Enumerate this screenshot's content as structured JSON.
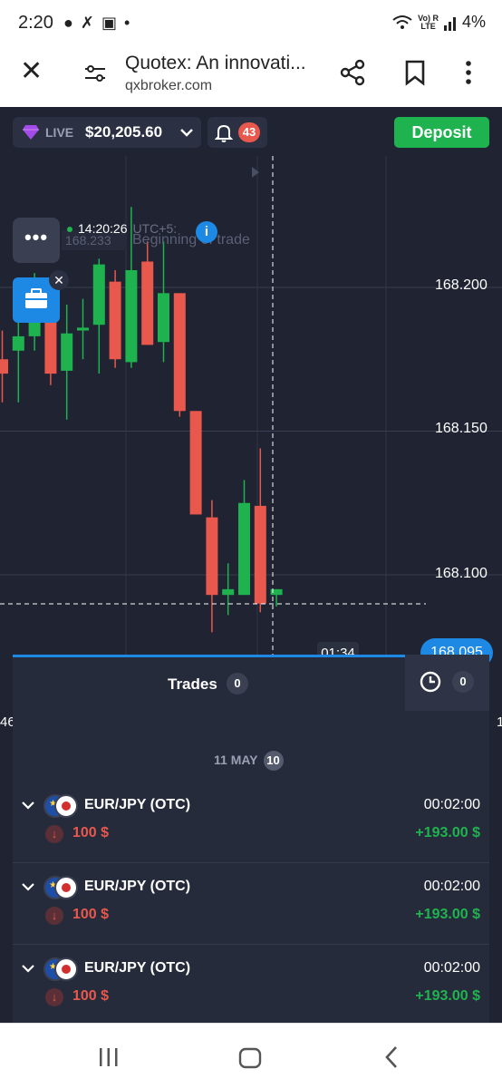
{
  "status_bar": {
    "time": "2:20",
    "signal_label": "Vo) R\nLTE",
    "battery": "4%"
  },
  "browser": {
    "title": "Quotex: An innovati...",
    "url": "qxbroker.com"
  },
  "account": {
    "mode": "LIVE",
    "balance": "$20,205.60",
    "notifications": "43",
    "deposit_label": "Deposit"
  },
  "chart": {
    "timestamp": "14:20:26",
    "timezone": "UTC+5:",
    "ghost_price": "168.233",
    "ghost_label": "Beginning of trade",
    "price_levels": [
      "168.200",
      "168.150",
      "168.100"
    ],
    "current_price": "168.095",
    "timer": "01:34",
    "colors": {
      "up": "#1fb34f",
      "down": "#e8584d",
      "accent": "#1e88e5"
    },
    "candles": [
      {
        "open": 168.175,
        "close": 168.17,
        "high": 168.185,
        "low": 168.16
      },
      {
        "open": 168.178,
        "close": 168.183,
        "high": 168.2,
        "low": 168.16
      },
      {
        "open": 168.183,
        "close": 168.196,
        "high": 168.205,
        "low": 168.178
      },
      {
        "open": 168.191,
        "close": 168.17,
        "high": 168.196,
        "low": 168.166
      },
      {
        "open": 168.171,
        "close": 168.184,
        "high": 168.194,
        "low": 168.154
      },
      {
        "open": 168.185,
        "close": 168.186,
        "high": 168.196,
        "low": 168.175
      },
      {
        "open": 168.187,
        "close": 168.208,
        "high": 168.21,
        "low": 168.17
      },
      {
        "open": 168.202,
        "close": 168.175,
        "high": 168.206,
        "low": 168.172
      },
      {
        "open": 168.174,
        "close": 168.206,
        "high": 168.228,
        "low": 168.172
      },
      {
        "open": 168.209,
        "close": 168.18,
        "high": 168.216,
        "low": 168.18
      },
      {
        "open": 168.181,
        "close": 168.198,
        "high": 168.216,
        "low": 168.174
      },
      {
        "open": 168.198,
        "close": 168.157,
        "high": 168.198,
        "low": 168.155
      },
      {
        "open": 168.157,
        "close": 168.121,
        "high": 168.157,
        "low": 168.121
      },
      {
        "open": 168.12,
        "close": 168.093,
        "high": 168.126,
        "low": 168.08
      },
      {
        "open": 168.093,
        "close": 168.095,
        "high": 168.104,
        "low": 168.086
      },
      {
        "open": 168.093,
        "close": 168.125,
        "high": 168.133,
        "low": 168.093
      },
      {
        "open": 168.124,
        "close": 168.09,
        "high": 168.144,
        "low": 168.087
      },
      {
        "open": 168.093,
        "close": 168.095,
        "high": 168.095,
        "low": 168.089
      }
    ]
  },
  "trades_panel": {
    "tab_label": "Trades",
    "open_count": "0",
    "history_count": "0",
    "side_left": "46",
    "side_right": "1",
    "date": "11 MAY",
    "date_count": "10",
    "items": [
      {
        "pair": "EUR/JPY (OTC)",
        "duration": "00:02:00",
        "amount": "100 $",
        "profit": "+193.00 $"
      },
      {
        "pair": "EUR/JPY (OTC)",
        "duration": "00:02:00",
        "amount": "100 $",
        "profit": "+193.00 $"
      },
      {
        "pair": "EUR/JPY (OTC)",
        "duration": "00:02:00",
        "amount": "100 $",
        "profit": "+193.00 $"
      }
    ]
  }
}
